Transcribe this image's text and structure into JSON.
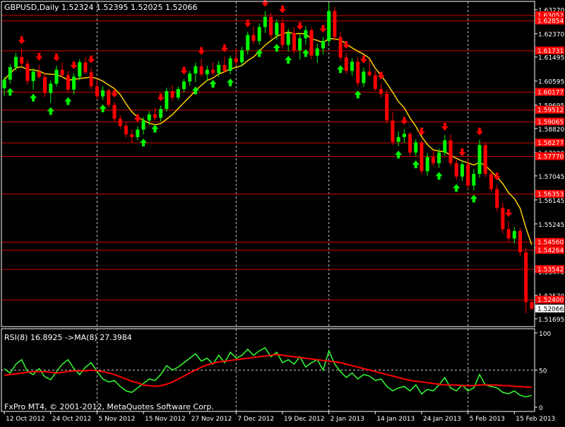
{
  "window": {
    "header": "GBPUSD,Daily  1.52324 1.52395 1.52025 1.52066",
    "footer": "FxPro MT4, © 2001-2012, MetaQuotes Software Corp."
  },
  "colors": {
    "background": "#000000",
    "frame": "#ffffff",
    "grid": "#c8c8c8",
    "bull": "#00ff00",
    "bear": "#ff0000",
    "ma": "#ffd200",
    "level_line": "#d00000",
    "level_label_bg": "#ff0000",
    "rsi": "#33ff33",
    "rsi_ma": "#ff0000"
  },
  "chart_data": [
    {
      "type": "candlestick",
      "title": "GBPUSD,Daily",
      "ohlc_last": [
        1.52324,
        1.52395,
        1.52025,
        1.52066
      ],
      "ylim": [
        1.514,
        1.6358
      ],
      "y_ticks": [
        "1.63270",
        "1.62370",
        "1.61495",
        "1.60595",
        "1.59695",
        "1.58820",
        "1.57920",
        "1.57045",
        "1.56145",
        "1.55245",
        "1.54345",
        "1.53470",
        "1.52570",
        "1.51695"
      ],
      "y_tick_values": [
        1.6327,
        1.6237,
        1.61495,
        1.60595,
        1.59695,
        1.5882,
        1.5792,
        1.57045,
        1.56145,
        1.55245,
        1.54345,
        1.5347,
        1.5257,
        1.51695
      ],
      "x_labels": [
        "12 Oct 2012",
        "24 Oct 2012",
        "5 Nov 2012",
        "15 Nov 2012",
        "27 Nov 2012",
        "7 Dec 2012",
        "19 Dec 2012",
        "2 Jan 2013",
        "14 Jan 2013",
        "24 Jan 2013",
        "5 Feb 2013",
        "15 Feb 2013"
      ],
      "x_label_index": [
        0,
        8,
        16,
        24,
        32,
        40,
        48,
        56,
        64,
        72,
        80,
        88
      ],
      "vgrid_index": [
        16,
        40,
        56,
        80
      ],
      "price_levels": [
        {
          "value": 1.6305,
          "label": "1.63052"
        },
        {
          "value": 1.6285,
          "label": "1.62854"
        },
        {
          "value": 1.6173,
          "label": "1.61731"
        },
        {
          "value": 1.6018,
          "label": "1.60177"
        },
        {
          "value": 1.5951,
          "label": "1.59512"
        },
        {
          "value": 1.5907,
          "label": "1.59065"
        },
        {
          "value": 1.5828,
          "label": "1.58277"
        },
        {
          "value": 1.5777,
          "label": "1.57770"
        },
        {
          "value": 1.5636,
          "label": "1.56353"
        },
        {
          "value": 1.5456,
          "label": "1.54560"
        },
        {
          "value": 1.5426,
          "label": "1.54264"
        },
        {
          "value": 1.5354,
          "label": "1.53542"
        },
        {
          "value": 1.524,
          "label": "1.52400"
        }
      ],
      "last_price": {
        "value": 1.52066,
        "label": "1.52066"
      },
      "candles": [
        [
          1.6033,
          1.6077,
          1.6005,
          1.6065
        ],
        [
          1.6065,
          1.6122,
          1.605,
          1.6112
        ],
        [
          1.6112,
          1.6165,
          1.6098,
          1.615
        ],
        [
          1.615,
          1.6182,
          1.6115,
          1.6125
        ],
        [
          1.6125,
          1.614,
          1.6045,
          1.606
        ],
        [
          1.606,
          1.6108,
          1.6028,
          1.6095
        ],
        [
          1.6095,
          1.612,
          1.6068,
          1.6075
        ],
        [
          1.6075,
          1.609,
          1.6,
          1.6015
        ],
        [
          1.6015,
          1.6062,
          1.5978,
          1.605
        ],
        [
          1.605,
          1.6118,
          1.6038,
          1.6102
        ],
        [
          1.6102,
          1.613,
          1.6072,
          1.6082
        ],
        [
          1.6082,
          1.6098,
          1.6015,
          1.6028
        ],
        [
          1.6028,
          1.6088,
          1.601,
          1.6076
        ],
        [
          1.6076,
          1.6142,
          1.6062,
          1.613
        ],
        [
          1.613,
          1.6148,
          1.6085,
          1.6092
        ],
        [
          1.6092,
          1.611,
          1.6028,
          1.604
        ],
        [
          1.604,
          1.6068,
          1.599,
          1.6002
        ],
        [
          1.6002,
          1.604,
          1.5988,
          1.6025
        ],
        [
          1.6025,
          1.6032,
          1.596,
          1.597
        ],
        [
          1.597,
          1.5982,
          1.5908,
          1.5918
        ],
        [
          1.5918,
          1.5932,
          1.588,
          1.5892
        ],
        [
          1.5892,
          1.5905,
          1.5848,
          1.586
        ],
        [
          1.586,
          1.5878,
          1.583,
          1.585
        ],
        [
          1.585,
          1.589,
          1.5838,
          1.5878
        ],
        [
          1.5878,
          1.5925,
          1.586,
          1.5912
        ],
        [
          1.5912,
          1.5948,
          1.5895,
          1.5935
        ],
        [
          1.5935,
          1.596,
          1.5912,
          1.5922
        ],
        [
          1.5922,
          1.5968,
          1.5908,
          1.5955
        ],
        [
          1.5955,
          1.6035,
          1.5945,
          1.6022
        ],
        [
          1.6022,
          1.6045,
          1.5985,
          1.5998
        ],
        [
          1.5998,
          1.604,
          1.5988,
          1.603
        ],
        [
          1.603,
          1.6068,
          1.6018,
          1.6058
        ],
        [
          1.6058,
          1.6098,
          1.6042,
          1.6088
        ],
        [
          1.6088,
          1.6128,
          1.6055,
          1.6115
        ],
        [
          1.6115,
          1.6142,
          1.6075,
          1.6085
        ],
        [
          1.6085,
          1.6118,
          1.606,
          1.6102
        ],
        [
          1.6102,
          1.613,
          1.608,
          1.609
        ],
        [
          1.609,
          1.6135,
          1.6075,
          1.612
        ],
        [
          1.612,
          1.6152,
          1.609,
          1.6098
        ],
        [
          1.6098,
          1.6155,
          1.6085,
          1.6145
        ],
        [
          1.6145,
          1.6185,
          1.6118,
          1.613
        ],
        [
          1.613,
          1.6188,
          1.6115,
          1.6175
        ],
        [
          1.6175,
          1.6245,
          1.616,
          1.6232
        ],
        [
          1.6232,
          1.6265,
          1.6198,
          1.621
        ],
        [
          1.621,
          1.6275,
          1.6195,
          1.6262
        ],
        [
          1.6262,
          1.6322,
          1.624,
          1.63
        ],
        [
          1.63,
          1.6315,
          1.6218,
          1.6232
        ],
        [
          1.6232,
          1.629,
          1.6215,
          1.6278
        ],
        [
          1.6278,
          1.6298,
          1.618,
          1.6195
        ],
        [
          1.6195,
          1.6255,
          1.617,
          1.624
        ],
        [
          1.624,
          1.6262,
          1.6162,
          1.6175
        ],
        [
          1.6175,
          1.6235,
          1.614,
          1.622
        ],
        [
          1.622,
          1.6265,
          1.6195,
          1.625
        ],
        [
          1.625,
          1.6262,
          1.614,
          1.6155
        ],
        [
          1.6155,
          1.62,
          1.6128,
          1.6182
        ],
        [
          1.6182,
          1.6225,
          1.616,
          1.621
        ],
        [
          1.621,
          1.6352,
          1.6195,
          1.6322
        ],
        [
          1.6322,
          1.6338,
          1.621,
          1.6225
        ],
        [
          1.6225,
          1.6245,
          1.6135,
          1.6148
        ],
        [
          1.6148,
          1.6165,
          1.6085,
          1.6098
        ],
        [
          1.6098,
          1.6145,
          1.608,
          1.6132
        ],
        [
          1.6132,
          1.615,
          1.604,
          1.6052
        ],
        [
          1.6052,
          1.611,
          1.6038,
          1.6095
        ],
        [
          1.6095,
          1.614,
          1.6075,
          1.6082
        ],
        [
          1.6082,
          1.6098,
          1.6022,
          1.603
        ],
        [
          1.603,
          1.605,
          1.5998,
          1.6012
        ],
        [
          1.6012,
          1.6028,
          1.59,
          1.5912
        ],
        [
          1.5912,
          1.5945,
          1.582,
          1.5832
        ],
        [
          1.5832,
          1.5872,
          1.5815,
          1.585
        ],
        [
          1.585,
          1.588,
          1.5828,
          1.5862
        ],
        [
          1.5862,
          1.587,
          1.578,
          1.5792
        ],
        [
          1.5792,
          1.5842,
          1.5778,
          1.583
        ],
        [
          1.583,
          1.584,
          1.571,
          1.5722
        ],
        [
          1.5722,
          1.579,
          1.5705,
          1.5775
        ],
        [
          1.5775,
          1.58,
          1.5742,
          1.5752
        ],
        [
          1.5752,
          1.5808,
          1.5735,
          1.5792
        ],
        [
          1.5792,
          1.5858,
          1.578,
          1.5838
        ],
        [
          1.5838,
          1.586,
          1.574,
          1.5752
        ],
        [
          1.5752,
          1.5765,
          1.569,
          1.5702
        ],
        [
          1.5702,
          1.5762,
          1.5685,
          1.5748
        ],
        [
          1.5748,
          1.5768,
          1.5655,
          1.5668
        ],
        [
          1.5668,
          1.573,
          1.565,
          1.5712
        ],
        [
          1.5712,
          1.584,
          1.5698,
          1.582
        ],
        [
          1.582,
          1.5832,
          1.57,
          1.5712
        ],
        [
          1.5712,
          1.5728,
          1.5645,
          1.5655
        ],
        [
          1.5655,
          1.5672,
          1.5572,
          1.5585
        ],
        [
          1.5585,
          1.5605,
          1.5488,
          1.5505
        ],
        [
          1.5505,
          1.5535,
          1.5455,
          1.547
        ],
        [
          1.547,
          1.5512,
          1.5452,
          1.5498
        ],
        [
          1.5498,
          1.551,
          1.5405,
          1.5418
        ],
        [
          1.5418,
          1.5435,
          1.519,
          1.5232
        ],
        [
          1.5232,
          1.524,
          1.5202,
          1.5207
        ]
      ],
      "arrows_down": [
        3,
        6,
        9,
        12,
        15,
        19,
        23,
        27,
        31,
        34,
        38,
        42,
        45,
        48,
        51,
        55,
        59,
        62,
        65,
        69,
        72,
        76,
        79,
        82,
        85,
        87
      ],
      "arrows_up": [
        1,
        5,
        8,
        11,
        17,
        24,
        26,
        33,
        36,
        39,
        44,
        47,
        49,
        52,
        58,
        61,
        68,
        71,
        75,
        78,
        81
      ]
    },
    {
      "type": "line",
      "title": "RSI(8) 16.8925  ->MA(8) 27.3984",
      "ylim": [
        0,
        100
      ],
      "y_ticks": [
        "100",
        "50",
        "0"
      ],
      "y_tick_values": [
        100,
        50,
        0
      ],
      "series": [
        {
          "name": "RSI(8)",
          "values": [
            52,
            46,
            58,
            64,
            48,
            44,
            52,
            41,
            37,
            48,
            58,
            64,
            52,
            44,
            54,
            60,
            48,
            38,
            34,
            36,
            28,
            22,
            20,
            26,
            32,
            38,
            36,
            44,
            56,
            50,
            54,
            60,
            66,
            72,
            62,
            66,
            58,
            70,
            60,
            74,
            66,
            70,
            78,
            70,
            76,
            80,
            68,
            74,
            60,
            64,
            58,
            68,
            54,
            60,
            64,
            50,
            76,
            58,
            48,
            40,
            46,
            38,
            44,
            42,
            36,
            38,
            28,
            22,
            26,
            28,
            22,
            30,
            18,
            24,
            22,
            30,
            40,
            26,
            22,
            30,
            22,
            26,
            44,
            30,
            28,
            26,
            20,
            18,
            22,
            16,
            14,
            16
          ]
        },
        {
          "name": "->MA(8)",
          "values": [
            43,
            44,
            45,
            46,
            47,
            48,
            48,
            48,
            47,
            46,
            47,
            48,
            49,
            49,
            49,
            50,
            49,
            48,
            46,
            44,
            41,
            38,
            35,
            33,
            30,
            29,
            28,
            29,
            31,
            34,
            38,
            42,
            46,
            50,
            54,
            57,
            59,
            61,
            62,
            63,
            64,
            65,
            66,
            67,
            68,
            69,
            70,
            71,
            70,
            69,
            68,
            67,
            66,
            65,
            64,
            63,
            62,
            61,
            60,
            58,
            56,
            54,
            52,
            50,
            48,
            46,
            44,
            42,
            40,
            38,
            36,
            35,
            34,
            33,
            32,
            31,
            30,
            30,
            30,
            29,
            29,
            29,
            30,
            30,
            30,
            30,
            29,
            29,
            28,
            28,
            27,
            27
          ]
        }
      ],
      "levels": [
        50
      ]
    }
  ]
}
